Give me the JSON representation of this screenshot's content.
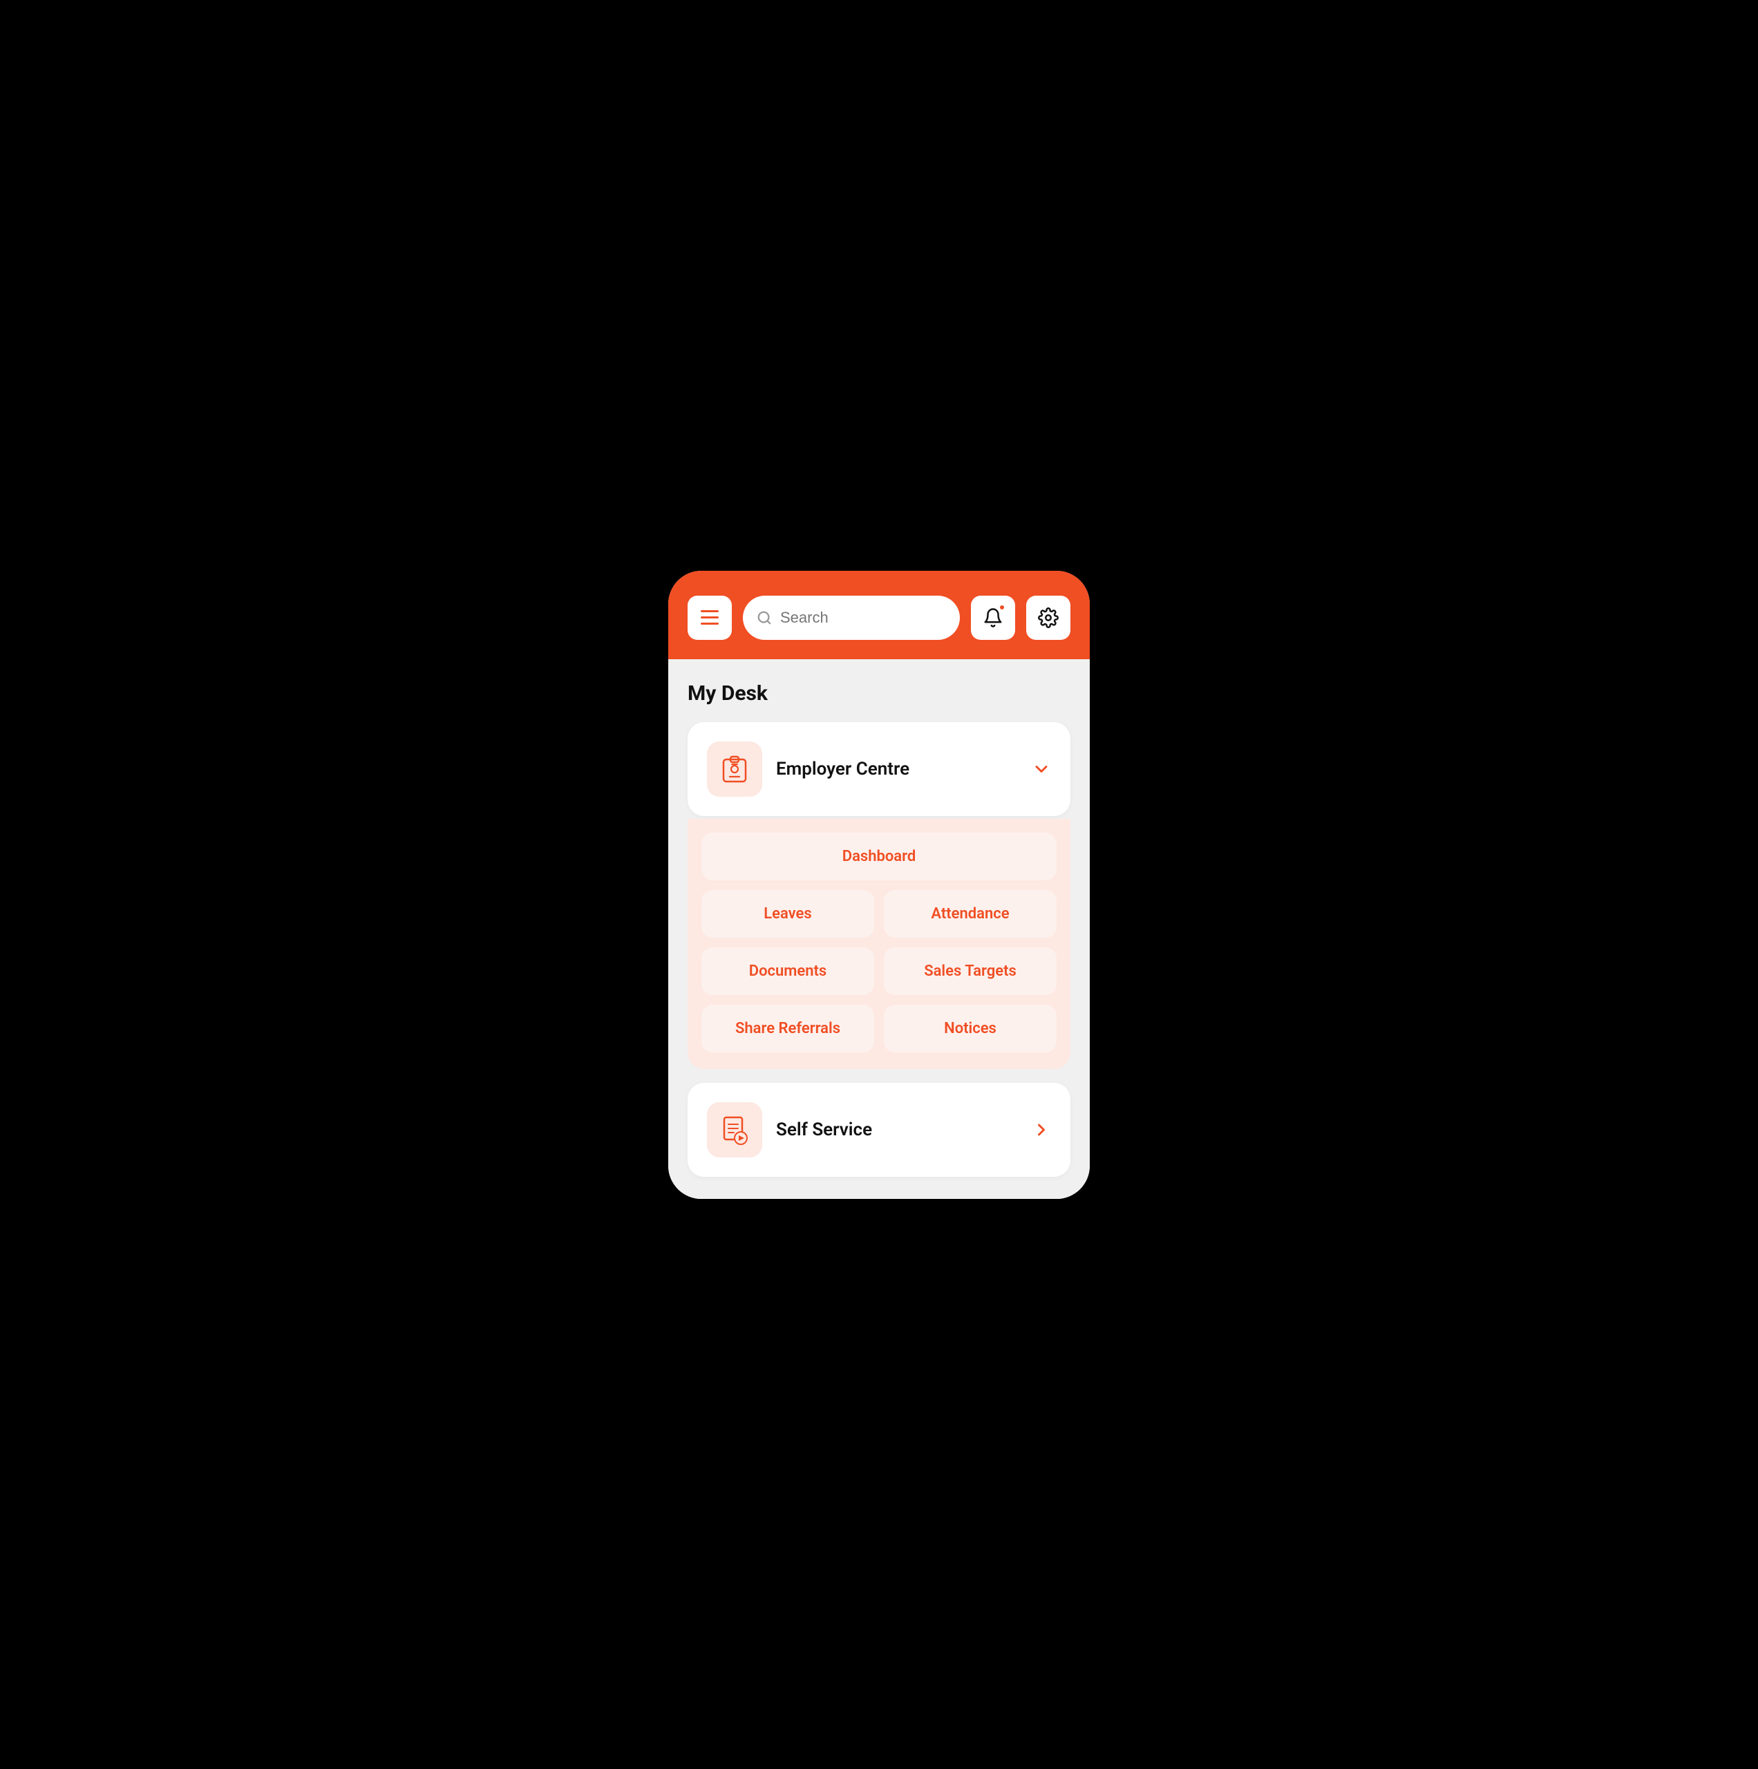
{
  "header": {
    "search_placeholder": "Search",
    "menu_label": "Menu",
    "notification_label": "Notifications",
    "settings_label": "Settings"
  },
  "page": {
    "title": "My Desk"
  },
  "employer_centre": {
    "label": "Employer Centre",
    "icon": "id-badge-icon",
    "expanded": true,
    "submenu": {
      "dashboard": "Dashboard",
      "leaves": "Leaves",
      "attendance": "Attendance",
      "documents": "Documents",
      "sales_targets": "Sales Targets",
      "share_referrals": "Share Referrals",
      "notices": "Notices"
    }
  },
  "self_service": {
    "label": "Self Service",
    "icon": "self-service-icon"
  },
  "colors": {
    "primary": "#f04e23",
    "icon_bg": "#fde8e2",
    "submenu_bg": "#fde8e2",
    "submenu_item_bg": "#fdf1ee",
    "white": "#ffffff"
  }
}
